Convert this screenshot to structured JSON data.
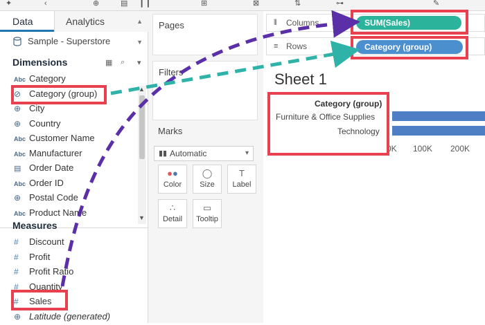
{
  "tabs": {
    "data": "Data",
    "analytics": "Analytics"
  },
  "datasource": "Sample - Superstore",
  "dimensions": {
    "title": "Dimensions",
    "items": [
      {
        "type": "Abc",
        "label": "Category"
      },
      {
        "type": "group",
        "label": "Category (group)"
      },
      {
        "type": "geo",
        "label": "City"
      },
      {
        "type": "geo",
        "label": "Country"
      },
      {
        "type": "Abc",
        "label": "Customer Name"
      },
      {
        "type": "Abc",
        "label": "Manufacturer"
      },
      {
        "type": "date",
        "label": "Order Date"
      },
      {
        "type": "Abc",
        "label": "Order ID"
      },
      {
        "type": "geo",
        "label": "Postal Code"
      },
      {
        "type": "Abc",
        "label": "Product Name"
      }
    ]
  },
  "measures": {
    "title": "Measures",
    "items": [
      {
        "type": "#",
        "label": "Discount",
        "italic": false
      },
      {
        "type": "#",
        "label": "Profit",
        "italic": false
      },
      {
        "type": "#",
        "label": "Profit Ratio",
        "italic": false
      },
      {
        "type": "#",
        "label": "Quantity",
        "italic": false
      },
      {
        "type": "#",
        "label": "Sales",
        "italic": false
      },
      {
        "type": "geo",
        "label": "Latitude (generated)",
        "italic": true
      }
    ]
  },
  "shelves": {
    "pages": "Pages",
    "filters": "Filters",
    "marks": "Marks",
    "marks_type": "Automatic",
    "mark_buttons": [
      "Color",
      "Size",
      "Label",
      "Detail",
      "Tooltip"
    ],
    "columns": "Columns",
    "rows": "Rows"
  },
  "pills": {
    "columns": "SUM(Sales)",
    "rows": "Category (group)"
  },
  "sheet": {
    "title": "Sheet 1",
    "row_header": "Category (group)",
    "rows": [
      "Furniture & Office Supplies",
      "Technology"
    ],
    "axis_ticks": [
      "0K",
      "100K",
      "200K"
    ]
  },
  "chart_data": {
    "type": "bar",
    "categories": [
      "Furniture & Office Supplies",
      "Technology"
    ],
    "values": [
      1460000,
      837000
    ],
    "xlabel": "",
    "ylabel": "Category (group)",
    "orientation": "horizontal"
  },
  "colors": {
    "pill_columns": "#2bb39b",
    "pill_rows": "#4c8fcf",
    "highlight": "#e8404f",
    "arrow_purple": "#5b2fa8",
    "arrow_teal": "#2fb3a8",
    "bar": "#4e7fc4"
  }
}
